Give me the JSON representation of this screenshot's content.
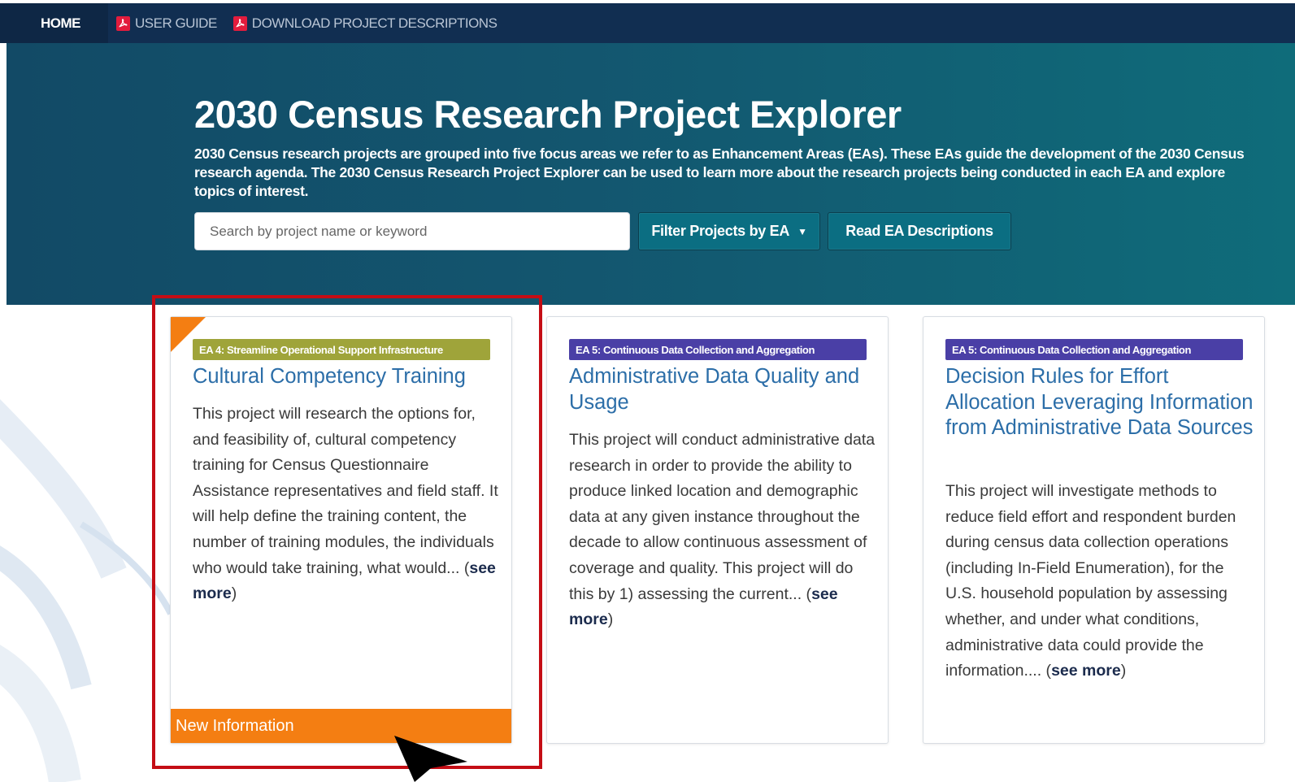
{
  "nav": {
    "home": "HOME",
    "user_guide": "USER GUIDE",
    "download": "DOWNLOAD PROJECT DESCRIPTIONS",
    "icons": {
      "pdf": "pdf-icon"
    }
  },
  "hero": {
    "title": "2030 Census Research Project Explorer",
    "description": "2030 Census research projects are grouped into five focus areas we refer to as Enhancement Areas (EAs). These EAs guide the development of the 2030 Census research agenda. The 2030 Census Research Project Explorer can be used to learn more about the research projects being conducted in each EA and explore topics of interest.",
    "search_placeholder": "Search by project name or keyword",
    "filter_button": "Filter Projects by EA",
    "read_button": "Read EA Descriptions"
  },
  "cards": [
    {
      "badge": "EA 4: Streamline Operational Support Infrastructure",
      "badge_color": "#9fa43a",
      "title": "Cultural Competency Training",
      "body": "This project will research the options for, and feasibility of, cultural competency training for Census Questionnaire Assistance representatives and field staff. It will help define the training content, the number of training modules, the individuals who would take training, what would...",
      "see_more": "see more",
      "footer": "New Information"
    },
    {
      "badge": "EA 5: Continuous Data Collection and Aggregation",
      "badge_color": "#4a3fa6",
      "title": "Administrative Data Quality and Usage",
      "body": "This project will conduct administrative data research in order to provide the ability to produce linked location and demographic data at any given instance throughout the decade to allow continuous assessment of coverage and quality. This project will do this by 1) assessing the current...",
      "see_more": "see more"
    },
    {
      "badge": "EA 5: Continuous Data Collection and Aggregation",
      "badge_color": "#4a3fa6",
      "title": "Decision Rules for Effort Allocation Leveraging Information from Administrative Data Sources",
      "body": "This project will investigate methods to reduce field effort and respondent burden during census data collection operations (including In-Field Enumeration), for the U.S. household population by assessing whether, and under what conditions, administrative data could provide the information....",
      "see_more": "see more"
    }
  ],
  "colors": {
    "nav_bg": "#112e51",
    "accent_orange": "#f47e12",
    "highlight_red": "#c40d15",
    "button_teal": "#0b6e82"
  }
}
